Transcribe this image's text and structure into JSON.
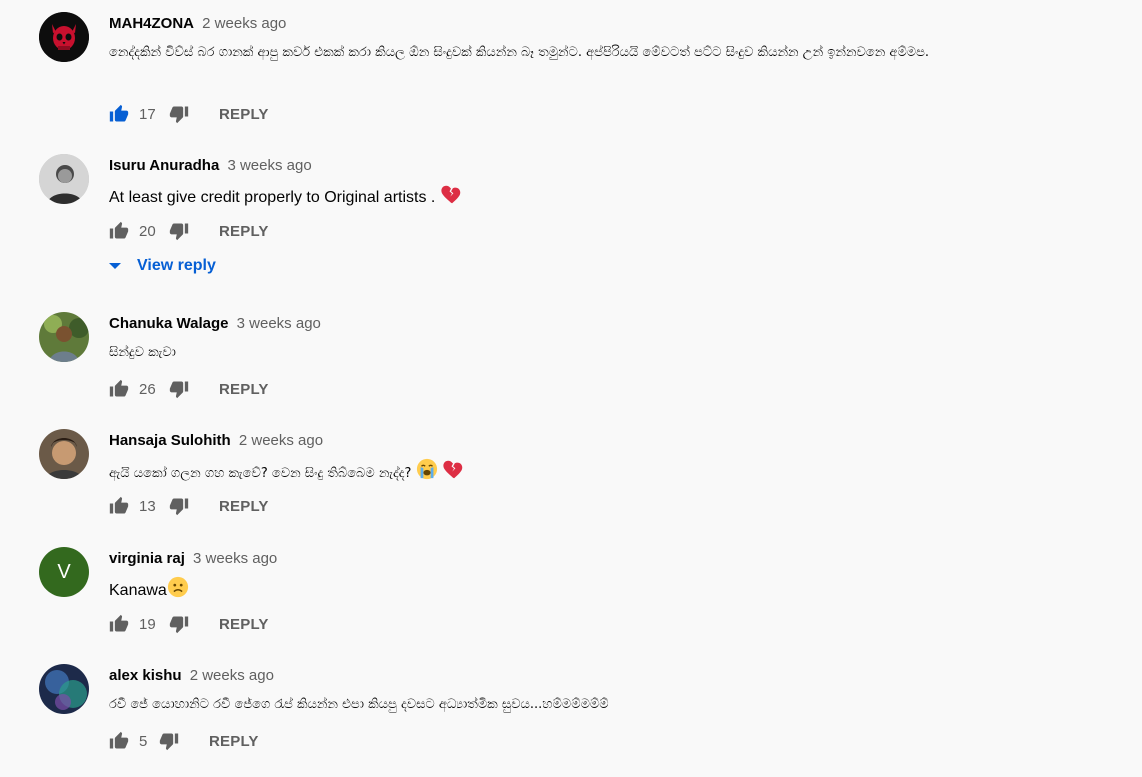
{
  "colors": {
    "background": "#f9f9f9",
    "author": "#030303",
    "meta": "#606060",
    "link": "#065fd4",
    "like_active": "#065fd4"
  },
  "comments": [
    {
      "author": "MAH4ZONA",
      "time": "2 weeks ago",
      "text": "නෙද්දකින් විව්ස් බර ගානක් ආපු කවර් එකක් කරා කියල ඕන සිංදුවක් කියන්න බෑ තමුන්ට. අප්පිරියයි මේවටත් පට්ට සිංදුව කියන්න උන් ඉන්නවනෙ අම්මප.",
      "likes": "17",
      "reply_label": "REPLY",
      "liked": true,
      "avatar_icon": "red-skull-avatar"
    },
    {
      "author": "Isuru Anuradha",
      "time": "3 weeks ago",
      "text": "At least give credit properly to Original artists .",
      "likes": "20",
      "reply_label": "REPLY",
      "view_reply_label": "View reply",
      "avatar_icon": "photo-avatar"
    },
    {
      "author": "Chanuka Walage",
      "time": "3 weeks ago",
      "text": "සින්දුව කැවා",
      "likes": "26",
      "reply_label": "REPLY",
      "avatar_icon": "photo-avatar"
    },
    {
      "author": "Hansaja Sulohith",
      "time": "2 weeks ago",
      "text": "ඇයි යකෝ ගලන ගහ කැවේ? වෙන සිංදු තිබ්බෙම නැද්ද?",
      "likes": "13",
      "reply_label": "REPLY",
      "avatar_icon": "photo-avatar"
    },
    {
      "author": "virginia raj",
      "time": "3 weeks ago",
      "text": "Kanawa",
      "likes": "19",
      "reply_label": "REPLY",
      "avatar_letter": "V",
      "avatar_color": "#33691e"
    },
    {
      "author": "alex kishu",
      "time": "2 weeks ago",
      "text": "රවී ජේ යොහානිට රවී ජේගෙ රැප් කියන්න එපා කියපු දවසට අධ්‍යාත්මික සුවය...හම්මම්මම්ම්",
      "likes": "5",
      "reply_label": "REPLY",
      "avatar_icon": "photo-avatar"
    }
  ]
}
